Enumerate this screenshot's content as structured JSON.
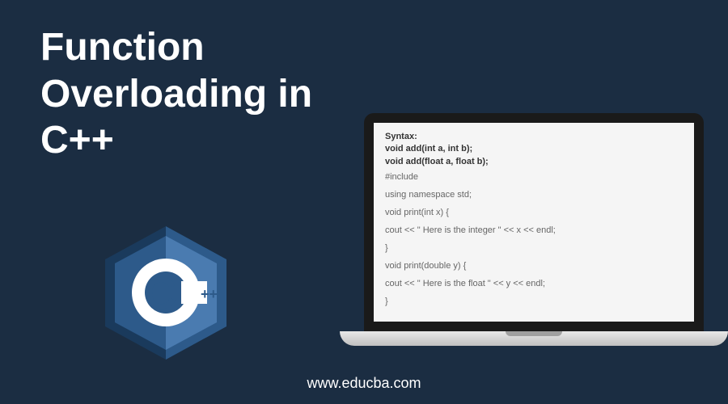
{
  "title_line1": "Function",
  "title_line2": "Overloading in",
  "title_line3": "C++",
  "logo": {
    "letter": "C",
    "plus": "++"
  },
  "code": {
    "line1": "Syntax:",
    "line2": "void add(int a, int b);",
    "line3": "void add(float a, float b);",
    "line4": "#include",
    "line5": "using namespace std;",
    "line6": "void print(int x) {",
    "line7": "cout << \" Here is the integer \" << x << endl;",
    "line8": "}",
    "line9": "void print(double  y) {",
    "line10": "cout << \" Here is the float \" << y << endl;",
    "line11": "}"
  },
  "footer": "www.educba.com"
}
